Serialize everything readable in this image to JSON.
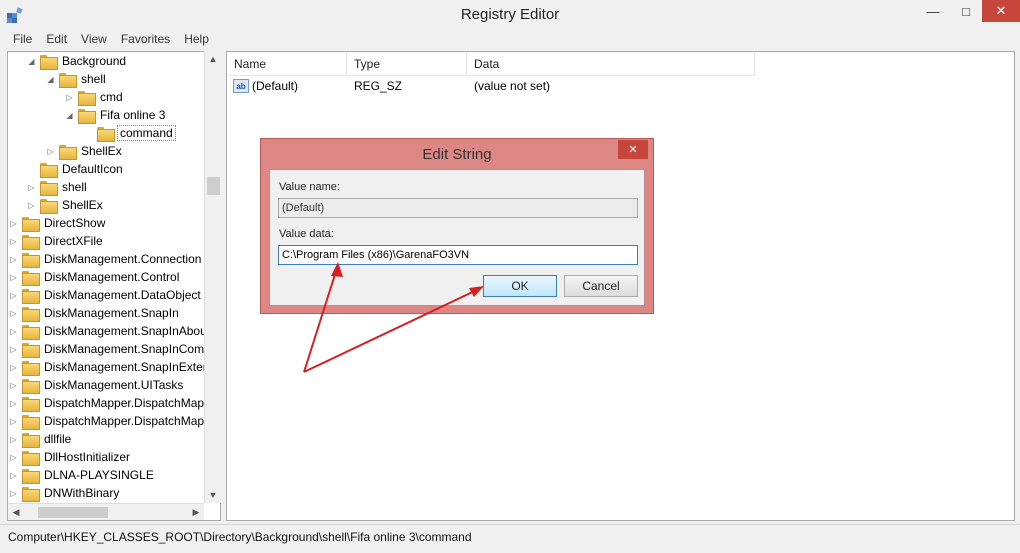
{
  "window": {
    "title": "Registry Editor",
    "minimize_glyph": "—",
    "maximize_glyph": "□",
    "close_glyph": "✕"
  },
  "menu": [
    "File",
    "Edit",
    "View",
    "Favorites",
    "Help"
  ],
  "tree": {
    "items": [
      {
        "label": "Background",
        "expanded": true
      },
      {
        "label": "shell",
        "expanded": true
      },
      {
        "label": "cmd",
        "expanded": false
      },
      {
        "label": "Fifa online 3",
        "expanded": true
      },
      {
        "label": "command",
        "selected": true
      },
      {
        "label": "ShellEx",
        "expanded": false
      },
      {
        "label": "DefaultIcon"
      },
      {
        "label": "shell",
        "expanded": false
      },
      {
        "label": "ShellEx",
        "expanded": false
      },
      {
        "label": "DirectShow",
        "expanded": false
      },
      {
        "label": "DirectXFile",
        "expanded": false
      },
      {
        "label": "DiskManagement.Connection",
        "expanded": false
      },
      {
        "label": "DiskManagement.Control",
        "expanded": false
      },
      {
        "label": "DiskManagement.DataObject",
        "expanded": false
      },
      {
        "label": "DiskManagement.SnapIn",
        "expanded": false
      },
      {
        "label": "DiskManagement.SnapInAbou",
        "expanded": false
      },
      {
        "label": "DiskManagement.SnapInCom",
        "expanded": false
      },
      {
        "label": "DiskManagement.SnapInExten",
        "expanded": false
      },
      {
        "label": "DiskManagement.UITasks",
        "expanded": false
      },
      {
        "label": "DispatchMapper.DispatchMap",
        "expanded": false
      },
      {
        "label": "DispatchMapper.DispatchMap",
        "expanded": false
      },
      {
        "label": "dllfile",
        "expanded": false
      },
      {
        "label": "DllHostInitializer",
        "expanded": false
      },
      {
        "label": "DLNA-PLAYSINGLE",
        "expanded": false
      },
      {
        "label": "DNWithBinary",
        "expanded": false
      }
    ]
  },
  "list": {
    "headers": {
      "name": "Name",
      "type": "Type",
      "data": "Data"
    },
    "rows": [
      {
        "icon": "string-value-icon",
        "icon_text": "ab",
        "name": "(Default)",
        "type": "REG_SZ",
        "data": "(value not set)"
      }
    ]
  },
  "statusbar": {
    "path": "Computer\\HKEY_CLASSES_ROOT\\Directory\\Background\\shell\\Fifa online 3\\command"
  },
  "dialog": {
    "title": "Edit String",
    "close_glyph": "✕",
    "value_name_label": "Value name:",
    "value_name": "(Default)",
    "value_data_label": "Value data:",
    "value_data": "C:\\Program Files (x86)\\GarenaFO3VN",
    "ok_label": "OK",
    "cancel_label": "Cancel"
  },
  "annotation": {
    "arrow_color": "#d42020"
  }
}
